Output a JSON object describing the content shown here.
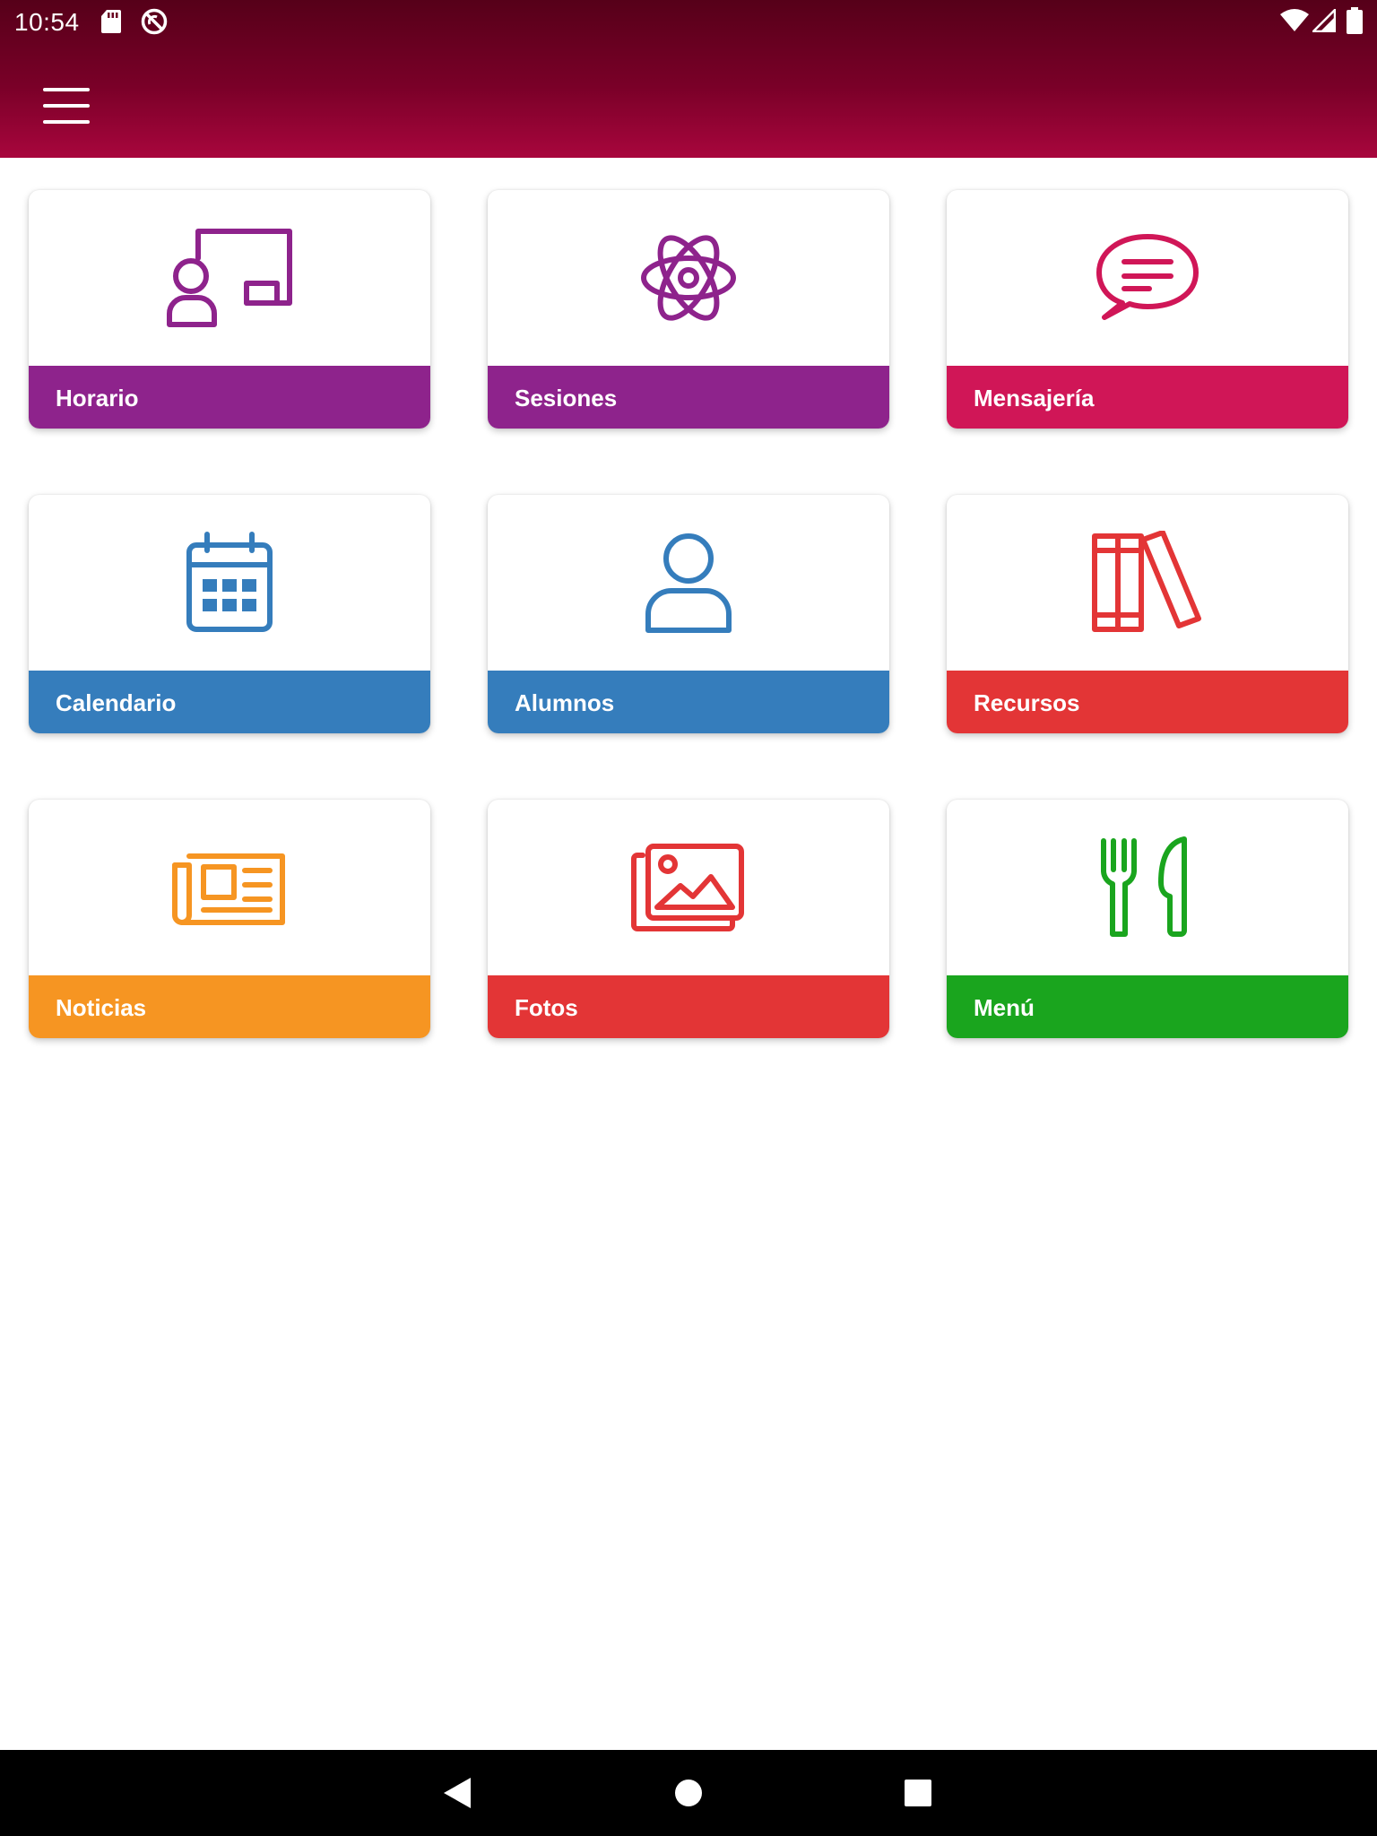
{
  "status_bar": {
    "time": "10:54"
  },
  "toolbar": {
    "menu_icon": "hamburger-icon"
  },
  "tiles": [
    {
      "label": "Horario",
      "icon": "teacher-board-icon",
      "color": "#8e238c"
    },
    {
      "label": "Sesiones",
      "icon": "atom-icon",
      "color": "#8e238c"
    },
    {
      "label": "Mensajería",
      "icon": "chat-bubble-icon",
      "color": "#d01657"
    },
    {
      "label": "Calendario",
      "icon": "calendar-icon",
      "color": "#357dbc"
    },
    {
      "label": "Alumnos",
      "icon": "user-icon",
      "color": "#357dbc"
    },
    {
      "label": "Recursos",
      "icon": "books-icon",
      "color": "#e33536"
    },
    {
      "label": "Noticias",
      "icon": "newspaper-icon",
      "color": "#f69522"
    },
    {
      "label": "Fotos",
      "icon": "photos-icon",
      "color": "#e33536"
    },
    {
      "label": "Menú",
      "icon": "fork-knife-icon",
      "color": "#1aa51e"
    }
  ],
  "colors": {
    "header_top": "#560019",
    "header_bottom": "#a8063d"
  }
}
